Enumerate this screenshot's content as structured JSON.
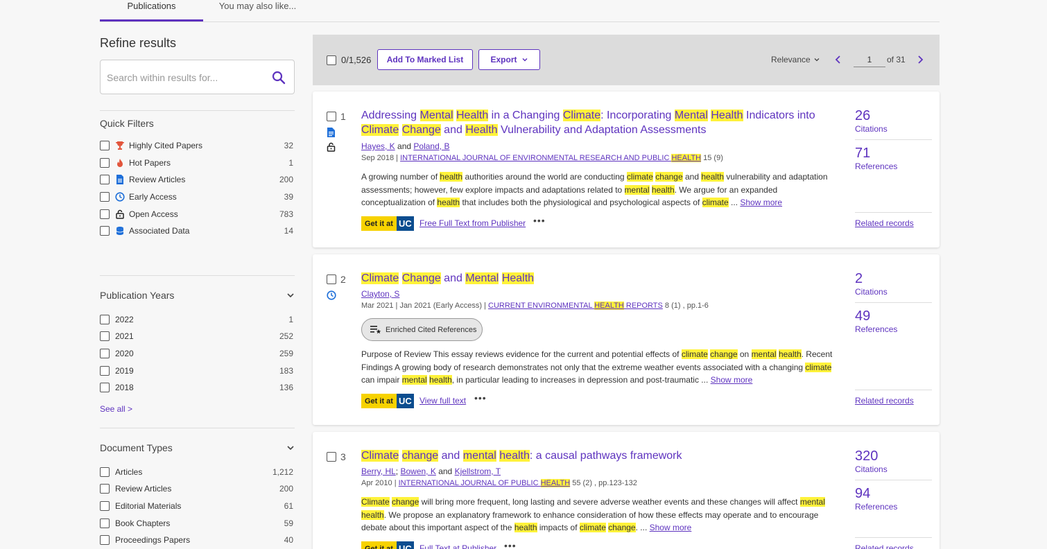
{
  "tabs": [
    {
      "label": "Publications"
    },
    {
      "label": "You may also like..."
    }
  ],
  "sidebar": {
    "title": "Refine results",
    "search_placeholder": "Search within results for...",
    "quick_filters": {
      "title": "Quick Filters",
      "items": [
        {
          "label": "Highly Cited Papers",
          "count": "32",
          "icon": "trophy-icon"
        },
        {
          "label": "Hot Papers",
          "count": "1",
          "icon": "flame-icon"
        },
        {
          "label": "Review Articles",
          "count": "200",
          "icon": "document-icon"
        },
        {
          "label": "Early Access",
          "count": "39",
          "icon": "clock-icon"
        },
        {
          "label": "Open Access",
          "count": "783",
          "icon": "lock-icon"
        },
        {
          "label": "Associated Data",
          "count": "14",
          "icon": "database-icon"
        }
      ]
    },
    "publication_years": {
      "title": "Publication Years",
      "items": [
        {
          "label": "2022",
          "count": "1"
        },
        {
          "label": "2021",
          "count": "252"
        },
        {
          "label": "2020",
          "count": "259"
        },
        {
          "label": "2019",
          "count": "183"
        },
        {
          "label": "2018",
          "count": "136"
        }
      ],
      "see_all": "See all >"
    },
    "document_types": {
      "title": "Document Types",
      "items": [
        {
          "label": "Articles",
          "count": "1,212"
        },
        {
          "label": "Review Articles",
          "count": "200"
        },
        {
          "label": "Editorial Materials",
          "count": "61"
        },
        {
          "label": "Book Chapters",
          "count": "59"
        },
        {
          "label": "Proceedings Papers",
          "count": "40"
        }
      ]
    }
  },
  "toolbar": {
    "selected_count": "0/1,526",
    "add_marked_list": "Add To Marked List",
    "export": "Export",
    "sort": "Relevance",
    "page": "1",
    "of_pages": "of 31"
  },
  "results": [
    {
      "num": "1",
      "authors_sep": "and",
      "authors": [
        "Hayes, K",
        "Poland, B"
      ],
      "date": "Sep 2018 |",
      "journal_pre": "INTERNATIONAL JOURNAL OF ENVIRONMENTAL RESEARCH AND PUBLIC ",
      "journal_hl": "HEALTH",
      "volume": "15 (9)",
      "show_more": "Show more",
      "getit_text": "Get it at",
      "getit_uc": "UC",
      "link": "Free Full Text from Publisher",
      "citations": "26",
      "citations_label": "Citations",
      "references": "71",
      "references_label": "References",
      "related": "Related records"
    },
    {
      "num": "2",
      "authors": [
        "Clayton, S"
      ],
      "date": "Mar 2021 | Jan 2021 (Early Access) |",
      "journal_pre": "CURRENT ENVIRONMENTAL ",
      "journal_hl": "HEALTH",
      "journal_post": " REPORTS",
      "volume": "8 (1) , pp.1-6",
      "enriched": "Enriched Cited References",
      "show_more": "Show more",
      "getit_text": "Get it at",
      "getit_uc": "UC",
      "link": "View full text",
      "citations": "2",
      "citations_label": "Citations",
      "references": "49",
      "references_label": "References",
      "related": "Related records"
    },
    {
      "num": "3",
      "authors_sep1": ";",
      "authors_sep2": "and",
      "authors": [
        "Berry, HL",
        "Bowen, K",
        "Kjellstrom, T"
      ],
      "date": "Apr 2010 |",
      "journal_pre": "INTERNATIONAL JOURNAL OF PUBLIC ",
      "journal_hl": "HEALTH",
      "volume": "55 (2) , pp.123-132",
      "show_more": "Show more",
      "getit_text": "Get it at",
      "getit_uc": "UC",
      "link": "Full Text at Publisher",
      "citations": "320",
      "citations_label": "Citations",
      "references": "94",
      "references_label": "References",
      "related": "Related records"
    }
  ],
  "text_fragments": {
    "r1_title": [
      "Addressing ",
      "Mental",
      " ",
      "Health",
      " in a Changing ",
      "Climate",
      ": Incorporating ",
      "Mental",
      " ",
      "Health",
      " Indicators into ",
      "Climate",
      " ",
      "Change",
      " and ",
      "Health",
      " Vulnerability and Adaptation Assessments"
    ],
    "r1_abstract": [
      "A growing number of ",
      "health",
      " authorities around the world are conducting ",
      "climate",
      " ",
      "change",
      " and ",
      "health",
      " vulnerability and adaptation assessments; however, few explore impacts and adaptations related to ",
      "mental",
      " ",
      "health",
      ". We argue for an expanded conceptualization of ",
      "health",
      " that includes both the physiological and psychological aspects of ",
      "climate",
      " ... "
    ],
    "r2_title": [
      "",
      "Climate",
      " ",
      "Change",
      " and ",
      "Mental",
      " ",
      "Health"
    ],
    "r2_abstract": [
      "Purpose of Review This essay reviews evidence for the current and potential effects of ",
      "climate",
      " ",
      "change",
      " on ",
      "mental",
      " ",
      "health",
      ". Recent Findings A growing body of research demonstrates not only that the extreme weather events associated with a changing ",
      "climate",
      " can impair ",
      "mental",
      " ",
      "health",
      ", in particular leading to increases in depression and post-traumatic  ... "
    ],
    "r3_title": [
      "",
      "Climate",
      " ",
      "change",
      " and ",
      "mental",
      " ",
      "health",
      ": a causal pathways framework"
    ],
    "r3_abstract": [
      "",
      "Climate",
      " ",
      "change",
      " will bring more frequent, long lasting and severe adverse weather events and these changes will affect ",
      "mental",
      " ",
      "health",
      ". We propose an explanatory framework to enhance consideration of how these effects may operate and to encourage debate about this important aspect of the ",
      "health",
      " impacts of ",
      "climate",
      " ",
      "change",
      ".                         ... "
    ]
  },
  "colors": {
    "accent": "#5e33bf",
    "highlight": "#fff23a",
    "getit_yellow": "#f7d200",
    "uc_blue": "#0b4d8f"
  }
}
